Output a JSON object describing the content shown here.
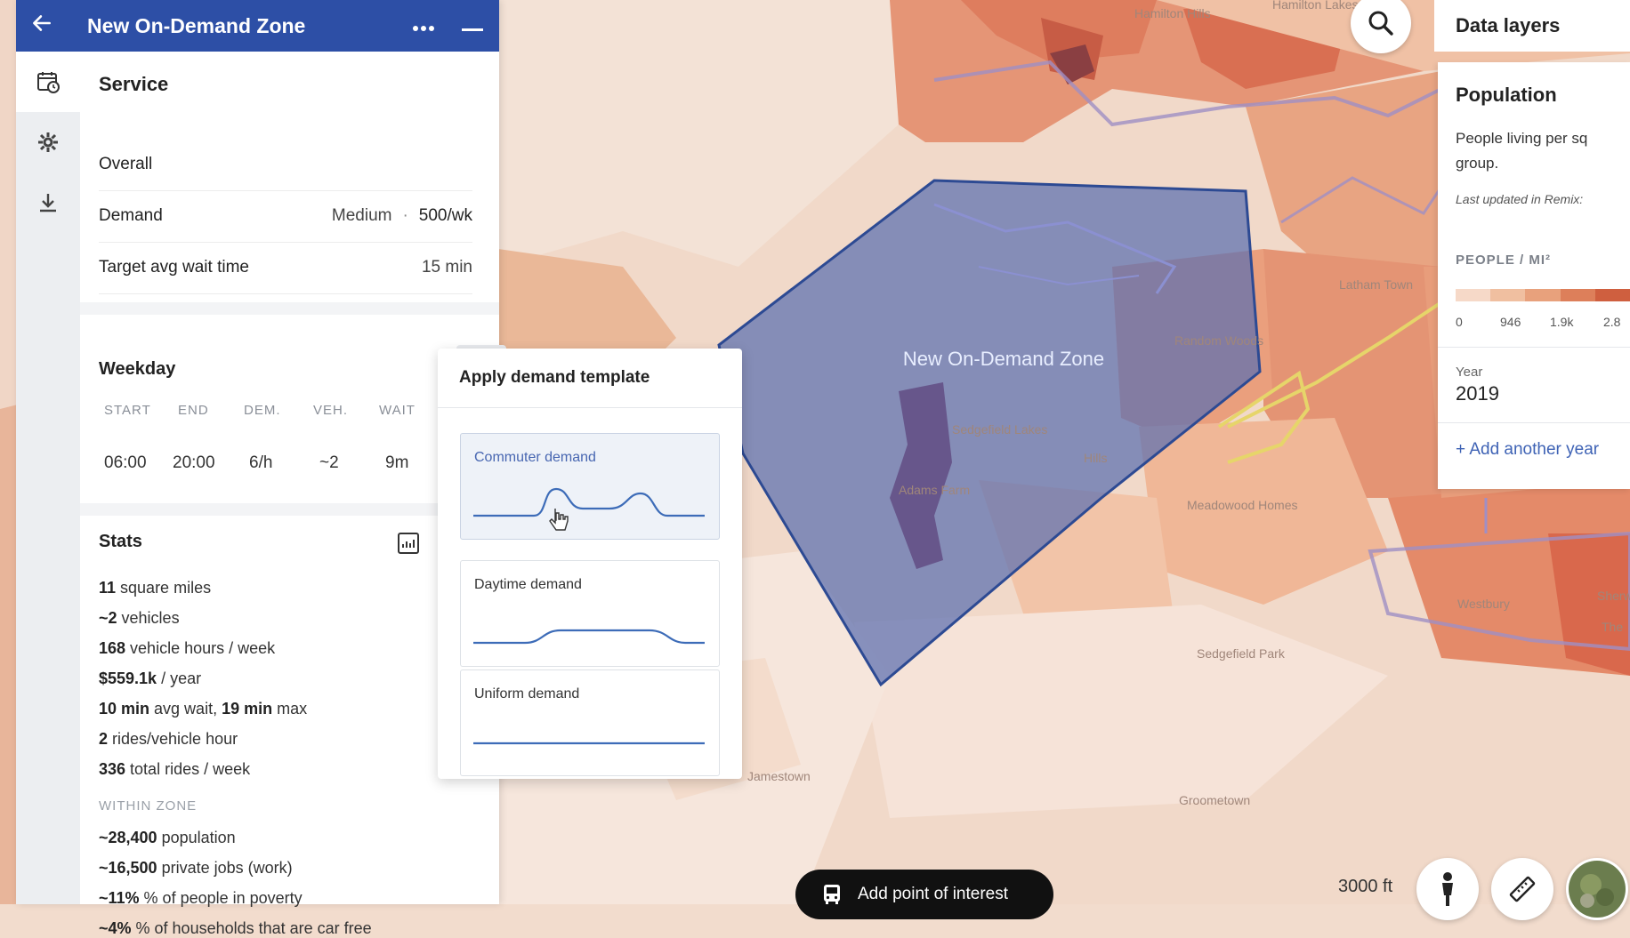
{
  "header": {
    "title": "New On-Demand Zone"
  },
  "service": {
    "title": "Service",
    "overall_label": "Overall",
    "demand_label": "Demand",
    "demand_value": "Medium",
    "demand_sep": "·",
    "demand_rate": "500/wk",
    "wait_label": "Target avg wait time",
    "wait_value": "15 min"
  },
  "weekday": {
    "title": "Weekday",
    "columns": [
      "START",
      "END",
      "DEM.",
      "VEH.",
      "WAIT"
    ],
    "row": [
      "06:00",
      "20:00",
      "6/h",
      "~2",
      "9m"
    ]
  },
  "stats": {
    "title": "Stats",
    "lines": [
      {
        "bold": "11",
        "text": " square miles"
      },
      {
        "bold": "~2",
        "text": " vehicles"
      },
      {
        "bold": "168",
        "text": " vehicle hours / week"
      },
      {
        "bold": "$559.1k",
        "text": " / year"
      },
      {
        "bold": "10 min",
        "text": " avg wait, "
      },
      {
        "bold": "2",
        "text": " rides/vehicle hour"
      },
      {
        "bold": "336",
        "text": " total rides / week"
      }
    ],
    "wait_max_bold": "19 min",
    "wait_max_text": " max",
    "within_zone": "WITHIN ZONE",
    "zone_lines": [
      {
        "bold": "~28,400",
        "text": " population"
      },
      {
        "bold": "~16,500",
        "text": " private jobs (work)"
      },
      {
        "bold": "~11%",
        "text": " % of people in poverty"
      },
      {
        "bold": "~4%",
        "text": " % of households that are car free"
      }
    ]
  },
  "template_popover": {
    "title": "Apply demand template",
    "options": [
      "Commuter demand",
      "Daytime demand",
      "Uniform demand"
    ],
    "selected": 0
  },
  "map": {
    "zone_label": "New On-Demand Zone",
    "place_labels": [
      "Hamilton Hills",
      "Hamilton Lakes",
      "Latham Town",
      "Random Woods",
      "Sedgefield Lakes",
      "Adams Farm",
      "Hills",
      "Meadowood Homes",
      "Westbury",
      "Sedgefield Park",
      "Groometown",
      "Jamestown",
      "Sherwood",
      "The"
    ],
    "zone_fill": "#5b6fb0",
    "zone_stroke": "#2d4a93"
  },
  "data_layers": {
    "title": "Data layers",
    "layer_title": "Population",
    "description_line1": "People living per sq",
    "description_line2": "group.",
    "updated": "Last updated in Remix:",
    "unit": "PEOPLE / MI²",
    "legend_colors": [
      "#f6d9c8",
      "#f0bfa0",
      "#e8a17c",
      "#dd7f5a",
      "#cf5f3f"
    ],
    "legend_ticks": [
      "0",
      "946",
      "1.9k",
      "2.8"
    ],
    "year_label": "Year",
    "year_value": "2019",
    "add_year": "+ Add another year"
  },
  "map_controls": {
    "add_poi": "Add point of interest",
    "scale": "3000 ft"
  }
}
